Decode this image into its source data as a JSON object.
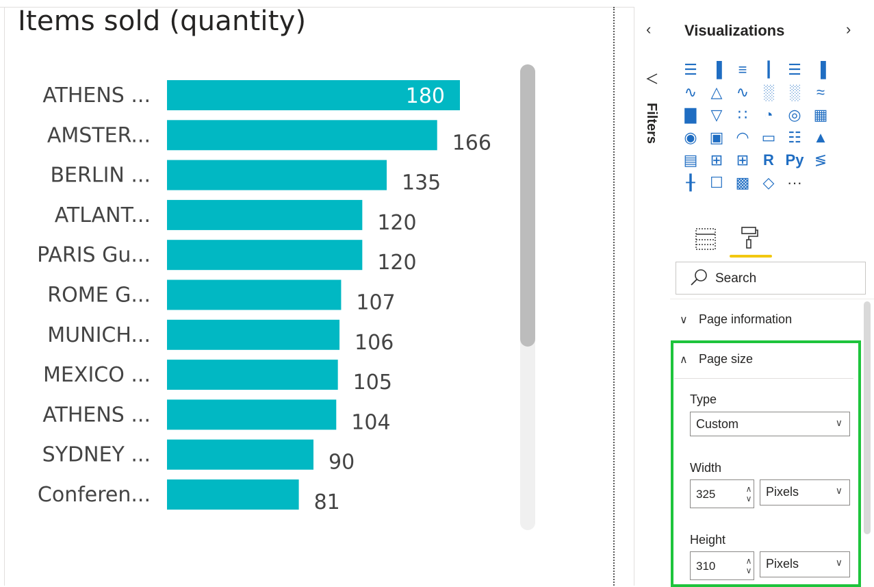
{
  "chart_data": {
    "type": "bar",
    "orientation": "horizontal",
    "title": "Items sold (quantity)",
    "categories": [
      "ATHENS ...",
      "AMSTER...",
      "BERLIN ...",
      "ATLANT...",
      "PARIS Gu...",
      "ROME G...",
      "MUNICH...",
      "MEXICO ...",
      "ATHENS ...",
      "SYDNEY ...",
      "Conferen..."
    ],
    "values": [
      180,
      166,
      135,
      120,
      120,
      107,
      106,
      105,
      104,
      90,
      81
    ],
    "bar_color": "#01b8c3",
    "first_label_inside": true
  },
  "filters": {
    "label": "Filters"
  },
  "viz": {
    "title": "Visualizations",
    "icons": [
      "stacked-bar-icon",
      "stacked-column-icon",
      "clustered-bar-icon",
      "clustered-column-icon",
      "100-stacked-bar-icon",
      "100-stacked-column-icon",
      "line-chart-icon",
      "area-chart-icon",
      "stacked-area-icon",
      "line-clustered-column-icon",
      "line-stacked-column-icon",
      "ribbon-chart-icon",
      "waterfall-icon",
      "funnel-icon",
      "scatter-icon",
      "pie-icon",
      "donut-icon",
      "treemap-icon",
      "map-icon",
      "filled-map-icon",
      "gauge-icon",
      "card-icon",
      "multirow-card-icon",
      "kpi-icon",
      "slicer-icon",
      "table-icon",
      "matrix-icon",
      "r-visual-icon",
      "python-visual-icon",
      "key-influencers-icon",
      "decomposition-tree-icon",
      "qa-icon",
      "arcgis-icon",
      "power-apps-icon",
      "more-visuals-icon"
    ],
    "r_label": "R",
    "py_label": "Py",
    "more_label": "···",
    "search_placeholder": "Search",
    "sections": {
      "page_information": "Page information",
      "page_size": "Page size"
    },
    "type_label": "Type",
    "type_value": "Custom",
    "width_label": "Width",
    "width_value": "325",
    "width_unit": "Pixels",
    "height_label": "Height",
    "height_value": "310",
    "height_unit": "Pixels",
    "highlight_color": "#1ec43c",
    "accent_color": "#f2c811"
  }
}
